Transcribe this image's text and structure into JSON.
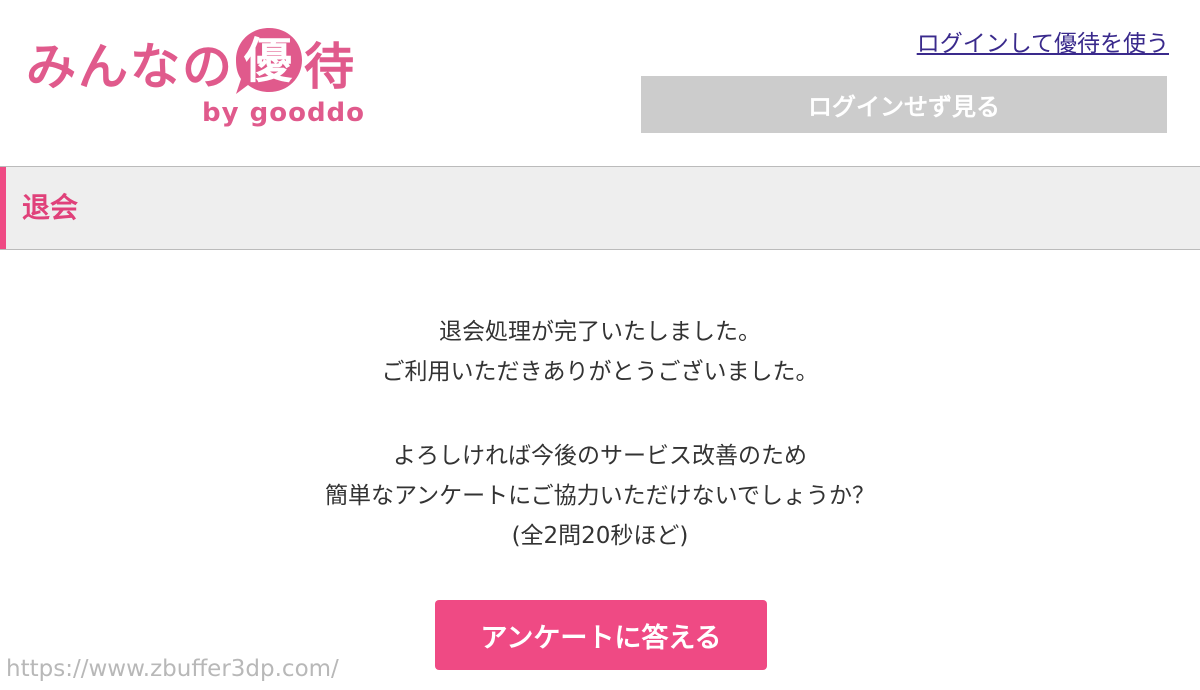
{
  "header": {
    "logo": {
      "text_before": "みんなの",
      "badge_text": "優",
      "text_after": "待",
      "subtitle": "by gooddo"
    },
    "login_link": "ログインして優待を使う",
    "guest_button": "ログインせず見る"
  },
  "section": {
    "title": "退会"
  },
  "message": {
    "lines": [
      "退会処理が完了いたしました。",
      "ご利用いただきありがとうございました。",
      "よろしければ今後のサービス改善のため",
      "簡単なアンケートにご協力いただけないでしょうか？",
      "(全2問20秒ほど)"
    ]
  },
  "survey_button": "アンケートに答える",
  "watermark": "https://www.zbuffer3dp.com/",
  "colors": {
    "brand_pink": "#e05a8c",
    "button_pink": "#ef4a84",
    "guest_gray": "#cccccc",
    "link_purple": "#3a2a8c"
  }
}
